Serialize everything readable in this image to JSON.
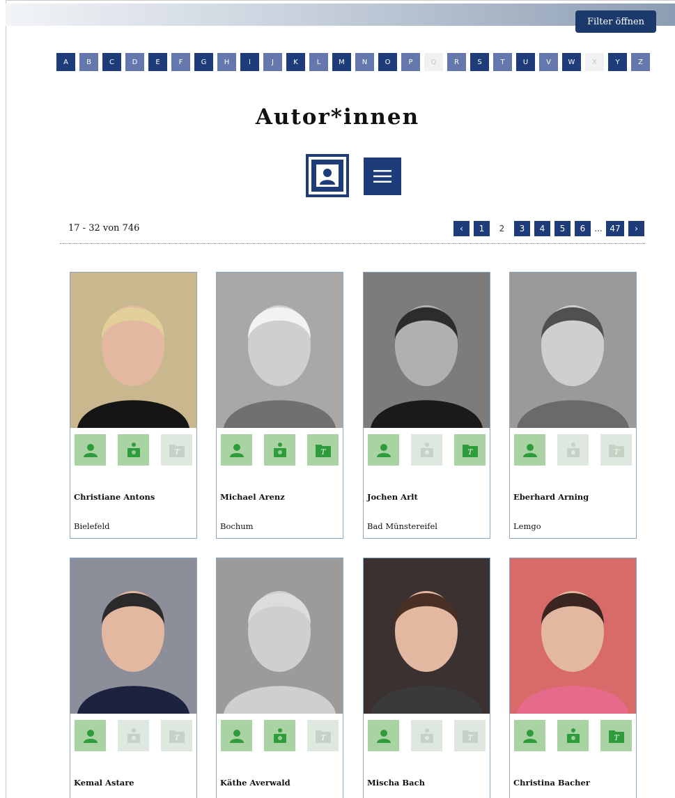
{
  "header": {
    "filter_label": "Filter öffnen"
  },
  "alphabet": [
    {
      "letter": "A",
      "state": "dark"
    },
    {
      "letter": "B",
      "state": "light"
    },
    {
      "letter": "C",
      "state": "dark"
    },
    {
      "letter": "D",
      "state": "light"
    },
    {
      "letter": "E",
      "state": "dark"
    },
    {
      "letter": "F",
      "state": "light"
    },
    {
      "letter": "G",
      "state": "dark"
    },
    {
      "letter": "H",
      "state": "light"
    },
    {
      "letter": "I",
      "state": "dark"
    },
    {
      "letter": "J",
      "state": "light"
    },
    {
      "letter": "K",
      "state": "dark"
    },
    {
      "letter": "L",
      "state": "light"
    },
    {
      "letter": "M",
      "state": "dark"
    },
    {
      "letter": "N",
      "state": "light"
    },
    {
      "letter": "O",
      "state": "dark"
    },
    {
      "letter": "P",
      "state": "light"
    },
    {
      "letter": "Q",
      "state": "off"
    },
    {
      "letter": "R",
      "state": "light"
    },
    {
      "letter": "S",
      "state": "dark"
    },
    {
      "letter": "T",
      "state": "light"
    },
    {
      "letter": "U",
      "state": "dark"
    },
    {
      "letter": "V",
      "state": "light"
    },
    {
      "letter": "W",
      "state": "dark"
    },
    {
      "letter": "X",
      "state": "off"
    },
    {
      "letter": "Y",
      "state": "dark"
    },
    {
      "letter": "Z",
      "state": "light"
    }
  ],
  "page_title": "Autor*innen",
  "results": {
    "range": "17 - 32 von 746"
  },
  "pagination": {
    "prev": "‹",
    "pages": [
      "1",
      "2",
      "3",
      "4",
      "5",
      "6"
    ],
    "current": "2",
    "ellipsis": "...",
    "last": "47",
    "next": "›"
  },
  "authors": [
    {
      "name": "Christiane Antons",
      "city": "Bielefeld",
      "icons": [
        true,
        true,
        false
      ],
      "photo_bg": "#c9b88e"
    },
    {
      "name": "Michael Arenz",
      "city": "Bochum",
      "icons": [
        true,
        true,
        true
      ],
      "photo_bg": "#a8a8a8"
    },
    {
      "name": "Jochen Arlt",
      "city": "Bad Münstereifel",
      "icons": [
        true,
        false,
        true
      ],
      "photo_bg": "#7c7c7c"
    },
    {
      "name": "Eberhard Arning",
      "city": "Lemgo",
      "icons": [
        true,
        false,
        false
      ],
      "photo_bg": "#9a9a9a"
    },
    {
      "name": "Kemal Astare",
      "city": "",
      "icons": [
        true,
        false,
        false
      ],
      "photo_bg": "#8c8f99"
    },
    {
      "name": "Käthe Averwald",
      "city": "",
      "icons": [
        true,
        true,
        false
      ],
      "photo_bg": "#9b9b9b"
    },
    {
      "name": "Mischa Bach",
      "city": "",
      "icons": [
        true,
        false,
        false
      ],
      "photo_bg": "#3b3130"
    },
    {
      "name": "Christina Bacher",
      "city": "",
      "icons": [
        true,
        true,
        true
      ],
      "photo_bg": "#d86a6a"
    }
  ],
  "colors": {
    "primary": "#1f3c7a",
    "primary_light": "#6578ad",
    "icon_on": "#a9d3a3",
    "icon_off": "#dfe8de",
    "icon_green": "#2e9c3a"
  }
}
